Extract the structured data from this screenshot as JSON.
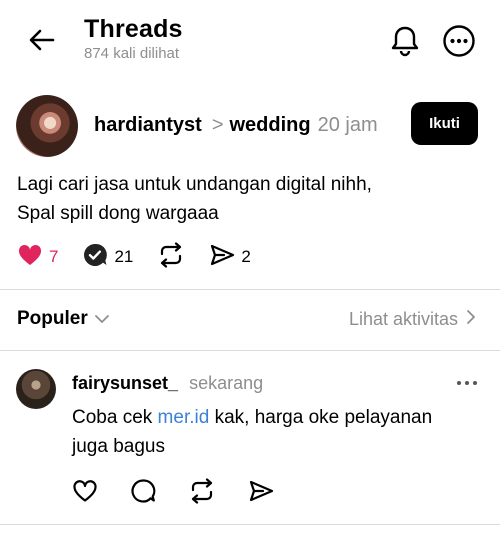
{
  "header": {
    "title": "Threads",
    "views": "874 kali dilihat"
  },
  "post": {
    "username": "hardiantyst",
    "separator": ">",
    "topic": "wedding",
    "time": "20 jam",
    "follow_label": "Ikuti",
    "text_line1": "Lagi cari jasa untuk undangan digital nihh,",
    "text_line2": "Spal spill dong wargaaa",
    "likes": "7",
    "replies": "21",
    "shares": "2",
    "liked": true,
    "like_color": "#e0245e"
  },
  "sort": {
    "label": "Populer",
    "activity_label": "Lihat aktivitas"
  },
  "reply": {
    "username": "fairysunset_",
    "time": "sekarang",
    "text_before": "Coba cek ",
    "link": "mer.id",
    "text_after": " kak, harga oke pelayanan",
    "text_line2": "juga bagus",
    "link_color": "#3b82d6"
  }
}
